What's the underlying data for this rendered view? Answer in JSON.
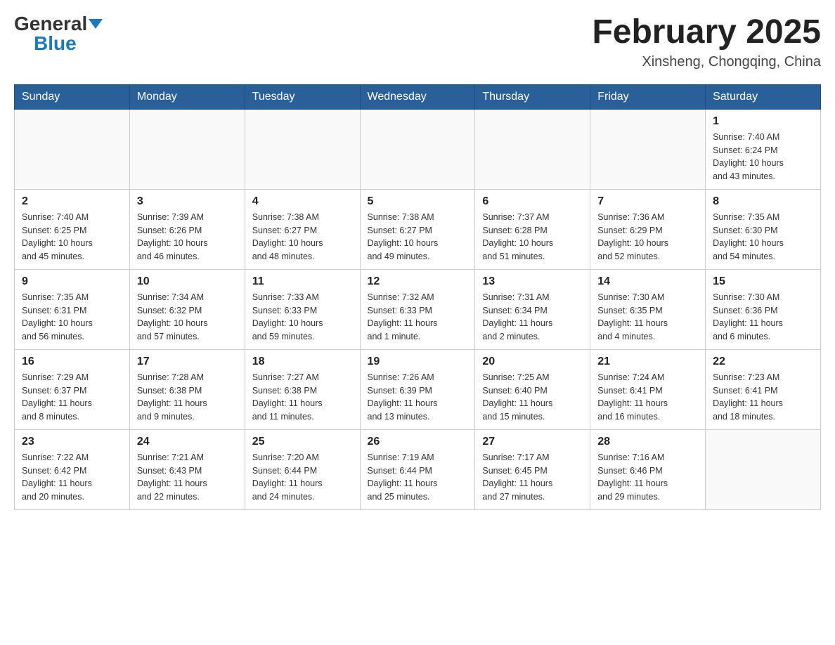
{
  "header": {
    "logo_general": "General",
    "logo_blue": "Blue",
    "month_title": "February 2025",
    "location": "Xinsheng, Chongqing, China"
  },
  "calendar": {
    "days_of_week": [
      "Sunday",
      "Monday",
      "Tuesday",
      "Wednesday",
      "Thursday",
      "Friday",
      "Saturday"
    ],
    "weeks": [
      {
        "days": [
          {
            "number": "",
            "info": ""
          },
          {
            "number": "",
            "info": ""
          },
          {
            "number": "",
            "info": ""
          },
          {
            "number": "",
            "info": ""
          },
          {
            "number": "",
            "info": ""
          },
          {
            "number": "",
            "info": ""
          },
          {
            "number": "1",
            "info": "Sunrise: 7:40 AM\nSunset: 6:24 PM\nDaylight: 10 hours\nand 43 minutes."
          }
        ]
      },
      {
        "days": [
          {
            "number": "2",
            "info": "Sunrise: 7:40 AM\nSunset: 6:25 PM\nDaylight: 10 hours\nand 45 minutes."
          },
          {
            "number": "3",
            "info": "Sunrise: 7:39 AM\nSunset: 6:26 PM\nDaylight: 10 hours\nand 46 minutes."
          },
          {
            "number": "4",
            "info": "Sunrise: 7:38 AM\nSunset: 6:27 PM\nDaylight: 10 hours\nand 48 minutes."
          },
          {
            "number": "5",
            "info": "Sunrise: 7:38 AM\nSunset: 6:27 PM\nDaylight: 10 hours\nand 49 minutes."
          },
          {
            "number": "6",
            "info": "Sunrise: 7:37 AM\nSunset: 6:28 PM\nDaylight: 10 hours\nand 51 minutes."
          },
          {
            "number": "7",
            "info": "Sunrise: 7:36 AM\nSunset: 6:29 PM\nDaylight: 10 hours\nand 52 minutes."
          },
          {
            "number": "8",
            "info": "Sunrise: 7:35 AM\nSunset: 6:30 PM\nDaylight: 10 hours\nand 54 minutes."
          }
        ]
      },
      {
        "days": [
          {
            "number": "9",
            "info": "Sunrise: 7:35 AM\nSunset: 6:31 PM\nDaylight: 10 hours\nand 56 minutes."
          },
          {
            "number": "10",
            "info": "Sunrise: 7:34 AM\nSunset: 6:32 PM\nDaylight: 10 hours\nand 57 minutes."
          },
          {
            "number": "11",
            "info": "Sunrise: 7:33 AM\nSunset: 6:33 PM\nDaylight: 10 hours\nand 59 minutes."
          },
          {
            "number": "12",
            "info": "Sunrise: 7:32 AM\nSunset: 6:33 PM\nDaylight: 11 hours\nand 1 minute."
          },
          {
            "number": "13",
            "info": "Sunrise: 7:31 AM\nSunset: 6:34 PM\nDaylight: 11 hours\nand 2 minutes."
          },
          {
            "number": "14",
            "info": "Sunrise: 7:30 AM\nSunset: 6:35 PM\nDaylight: 11 hours\nand 4 minutes."
          },
          {
            "number": "15",
            "info": "Sunrise: 7:30 AM\nSunset: 6:36 PM\nDaylight: 11 hours\nand 6 minutes."
          }
        ]
      },
      {
        "days": [
          {
            "number": "16",
            "info": "Sunrise: 7:29 AM\nSunset: 6:37 PM\nDaylight: 11 hours\nand 8 minutes."
          },
          {
            "number": "17",
            "info": "Sunrise: 7:28 AM\nSunset: 6:38 PM\nDaylight: 11 hours\nand 9 minutes."
          },
          {
            "number": "18",
            "info": "Sunrise: 7:27 AM\nSunset: 6:38 PM\nDaylight: 11 hours\nand 11 minutes."
          },
          {
            "number": "19",
            "info": "Sunrise: 7:26 AM\nSunset: 6:39 PM\nDaylight: 11 hours\nand 13 minutes."
          },
          {
            "number": "20",
            "info": "Sunrise: 7:25 AM\nSunset: 6:40 PM\nDaylight: 11 hours\nand 15 minutes."
          },
          {
            "number": "21",
            "info": "Sunrise: 7:24 AM\nSunset: 6:41 PM\nDaylight: 11 hours\nand 16 minutes."
          },
          {
            "number": "22",
            "info": "Sunrise: 7:23 AM\nSunset: 6:41 PM\nDaylight: 11 hours\nand 18 minutes."
          }
        ]
      },
      {
        "days": [
          {
            "number": "23",
            "info": "Sunrise: 7:22 AM\nSunset: 6:42 PM\nDaylight: 11 hours\nand 20 minutes."
          },
          {
            "number": "24",
            "info": "Sunrise: 7:21 AM\nSunset: 6:43 PM\nDaylight: 11 hours\nand 22 minutes."
          },
          {
            "number": "25",
            "info": "Sunrise: 7:20 AM\nSunset: 6:44 PM\nDaylight: 11 hours\nand 24 minutes."
          },
          {
            "number": "26",
            "info": "Sunrise: 7:19 AM\nSunset: 6:44 PM\nDaylight: 11 hours\nand 25 minutes."
          },
          {
            "number": "27",
            "info": "Sunrise: 7:17 AM\nSunset: 6:45 PM\nDaylight: 11 hours\nand 27 minutes."
          },
          {
            "number": "28",
            "info": "Sunrise: 7:16 AM\nSunset: 6:46 PM\nDaylight: 11 hours\nand 29 minutes."
          },
          {
            "number": "",
            "info": ""
          }
        ]
      }
    ]
  }
}
